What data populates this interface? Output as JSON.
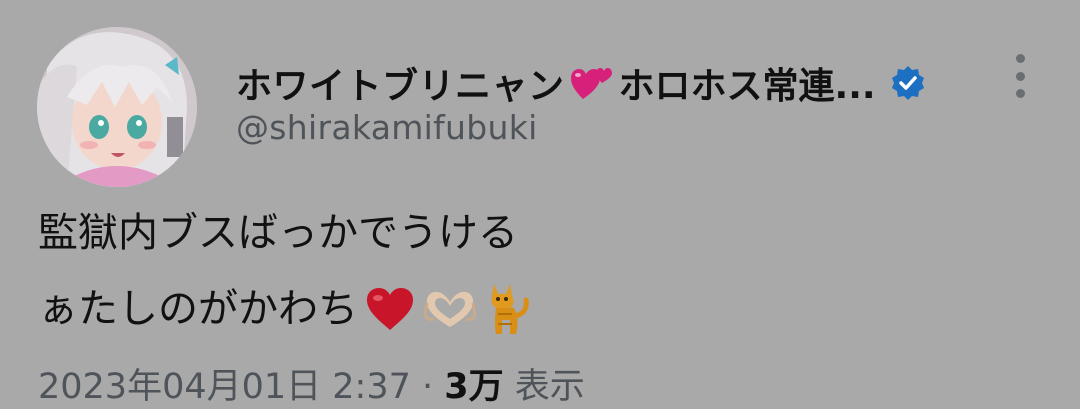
{
  "author": {
    "display_name": "ホワイトブリニャン",
    "name_emoji": "two-hearts-emoji",
    "name_tail": "ホロホス常連...",
    "handle": "@shirakamifubuki",
    "verified": true,
    "verified_color": "#1d6fc1"
  },
  "avatar": {
    "icon": "avatar-image"
  },
  "menu": {
    "icon": "more-vertical-icon"
  },
  "tweet": {
    "line1": "監獄内ブスばっかでうける",
    "line2": "ぁたしのがかわち",
    "line2_emojis": [
      "red-heart-emoji",
      "heart-hands-emoji",
      "cat-emoji"
    ]
  },
  "meta": {
    "timestamp": "2023年04月01日 2:37",
    "separator": " · ",
    "views_count": "3万",
    "views_label": " 表示"
  },
  "colors": {
    "background": "#a9a9a9",
    "primary_text": "#111111",
    "secondary_text": "#4f545a",
    "accent_heart": "#d6207a",
    "red_heart": "#c8152a"
  }
}
